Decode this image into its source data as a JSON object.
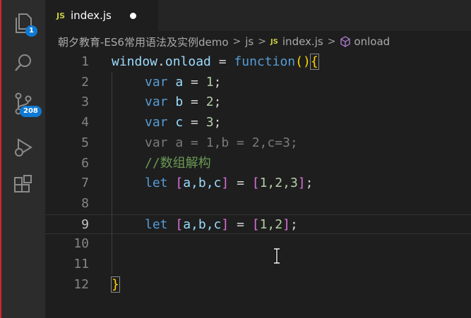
{
  "colors": {
    "keyword": "#569cd6",
    "identifier": "#9cdcfe",
    "function_keyword": "#569cd6",
    "number": "#b5cea8",
    "comment": "#6a9955",
    "bracket_gold": "#ffd700",
    "bracket_purple": "#da70d6",
    "bracket_blue": "#179fff",
    "operator": "#d4d4d4",
    "js_badge": "#cbcb41",
    "activity_badge": "#0e7ad3"
  },
  "activity_bar": {
    "explorer_badge": "1",
    "scm_badge": "208"
  },
  "tab": {
    "lang_label": "JS",
    "file_name": "index.js"
  },
  "breadcrumb": {
    "folder": "朝夕教育-ES6常用语法及实例demo",
    "sub": "js",
    "js_badge": "JS",
    "file": "index.js",
    "symbol": "onload"
  },
  "code_lines": [
    {
      "num": "1",
      "tokens": {
        "a": "window",
        "b": ".",
        "c": "onload",
        "d": " = ",
        "e": "function",
        "f": "(",
        "g": ")",
        "h": "{"
      }
    },
    {
      "num": "2",
      "tokens": {
        "a": "var",
        "b": " ",
        "c": "a",
        "d": " = ",
        "e": "1",
        "f": ";"
      }
    },
    {
      "num": "3",
      "tokens": {
        "a": "var",
        "b": " ",
        "c": "b",
        "d": " = ",
        "e": "2",
        "f": ";"
      }
    },
    {
      "num": "4",
      "tokens": {
        "a": "var",
        "b": " ",
        "c": "c",
        "d": " = ",
        "e": "3",
        "f": ";"
      }
    },
    {
      "num": "5",
      "text": "var a = 1,b = 2,c=3;"
    },
    {
      "num": "6",
      "text": "//数组解构"
    },
    {
      "num": "7",
      "tokens": {
        "a": "let",
        "b": " ",
        "c": "[",
        "d": "a,b,c",
        "e": "]",
        "f": " = ",
        "g": "[",
        "h": "1,2,3",
        "i": "]",
        "j": ";"
      }
    },
    {
      "num": "8",
      "text": ""
    },
    {
      "num": "9",
      "tokens": {
        "a": "let",
        "b": " ",
        "c": "[",
        "d": "a,b,c",
        "e": "]",
        "f": " = ",
        "g": "[",
        "h": "1,2",
        "i": "]",
        "j": ";"
      }
    },
    {
      "num": "10",
      "text": ""
    },
    {
      "num": "11",
      "text": ""
    },
    {
      "num": "12",
      "tokens": {
        "a": "}"
      }
    }
  ]
}
